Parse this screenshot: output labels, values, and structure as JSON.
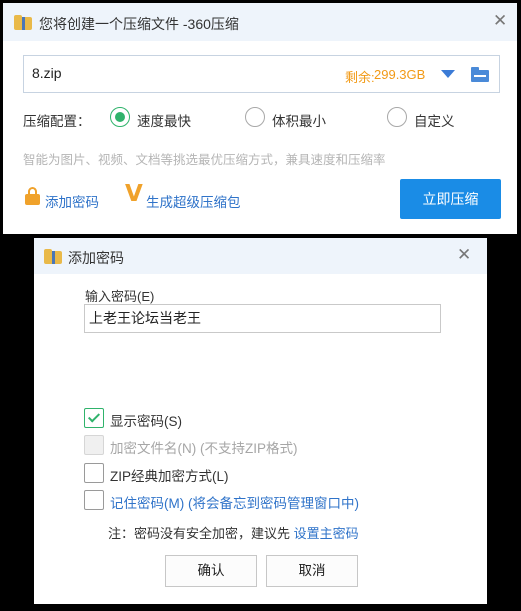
{
  "compress_window": {
    "title": "您将创建一个压缩文件 -360压缩",
    "path": {
      "value": "8.zip",
      "space_label": "剩余:",
      "space_value": "299.3GB"
    },
    "config": {
      "label": "压缩配置：",
      "options": [
        {
          "label": "速度最快",
          "checked": true
        },
        {
          "label": "体积最小",
          "checked": false
        },
        {
          "label": "自定义",
          "checked": false
        }
      ]
    },
    "hint": "智能为图片、视频、文档等挑选最优压缩方式，兼具速度和压缩率",
    "add_password_link": "添加密码",
    "super_package_link": "生成超级压缩包",
    "compress_button": "立即压缩"
  },
  "password_dialog": {
    "title": "添加密码",
    "input_label": "输入密码(E)",
    "input_value": "上老王论坛当老王",
    "checkboxes": [
      {
        "label": "显示密码(S)",
        "checked": true,
        "enabled": true
      },
      {
        "label": "加密文件名(N) (不支持ZIP格式)",
        "checked": false,
        "enabled": false
      },
      {
        "label": "ZIP经典加密方式(L)",
        "checked": false,
        "enabled": true
      },
      {
        "label": "记住密码(M) (将会备忘到密码管理窗口中)",
        "checked": false,
        "enabled": true
      }
    ],
    "note_text": "注：密码没有安全加密，建议先 ",
    "note_link": "设置主密码",
    "ok_button": "确认",
    "cancel_button": "取消"
  },
  "colors": {
    "accent_blue": "#1a8ce6",
    "link_blue": "#2f73c9",
    "space_orange": "#f29a16",
    "check_green": "#2fb36b",
    "titlebar_bg": "#eef4fb"
  },
  "icons": [
    "app-zip-icon",
    "close-icon",
    "dropdown-arrow-icon",
    "folder-icon",
    "lock-icon",
    "v-icon",
    "check-icon"
  ]
}
